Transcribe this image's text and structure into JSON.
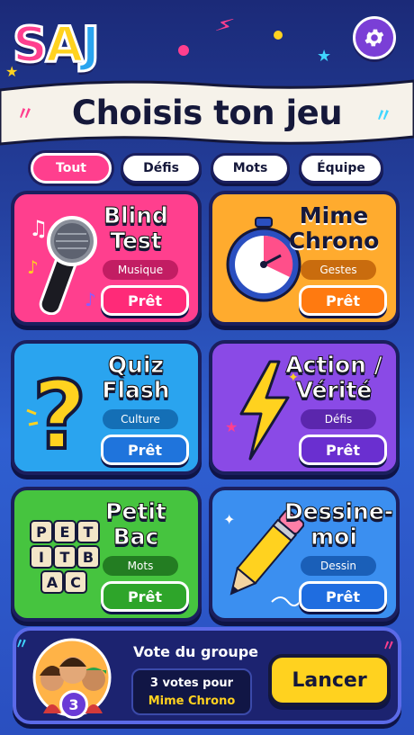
{
  "app": {
    "logo_letters": [
      "S",
      "A",
      "J"
    ],
    "title": "Choisis ton jeu"
  },
  "colors": {
    "pink": "#ff3f8e",
    "orange": "#ff9a1f",
    "blue": "#2aa4ef",
    "purple": "#7a3fd6",
    "green": "#3fbf3a",
    "navy": "#1b1f5e",
    "yellow": "#ffd21f"
  },
  "tabs": [
    {
      "label": "Tout",
      "active": true
    },
    {
      "label": "Défis",
      "active": false
    },
    {
      "label": "Mots",
      "active": false
    },
    {
      "label": "Équipe",
      "active": false
    }
  ],
  "games": [
    {
      "name_line1": "Blind",
      "name_line2": "Test",
      "tag": "Musique",
      "button": "Prêt",
      "icon": "microphone-icon"
    },
    {
      "name_line1": "Mime",
      "name_line2": "Chrono",
      "tag": "Gestes",
      "button": "Prêt",
      "icon": "stopwatch-icon"
    },
    {
      "name_line1": "Quiz",
      "name_line2": "Flash",
      "tag": "Culture",
      "button": "Prêt",
      "icon": "question-mark-icon"
    },
    {
      "name_line1": "Action /",
      "name_line2": "Vérité",
      "tag": "Défis",
      "button": "Prêt",
      "icon": "lightning-icon"
    },
    {
      "name_line1": "Petit",
      "name_line2": "Bac",
      "tag": "Mots",
      "button": "Prêt",
      "icon": "letter-tiles-icon",
      "tiles": [
        "P",
        "E",
        "T",
        "I",
        "T",
        "B",
        "A",
        "C"
      ]
    },
    {
      "name_line1": "Dessine-",
      "name_line2": "moi",
      "tag": "Dessin",
      "button": "Prêt",
      "icon": "pencil-icon"
    }
  ],
  "vote": {
    "title": "Vote du groupe",
    "count": "3",
    "line1": "3 votes pour",
    "line2": "Mime Chrono",
    "button": "Lancer"
  }
}
